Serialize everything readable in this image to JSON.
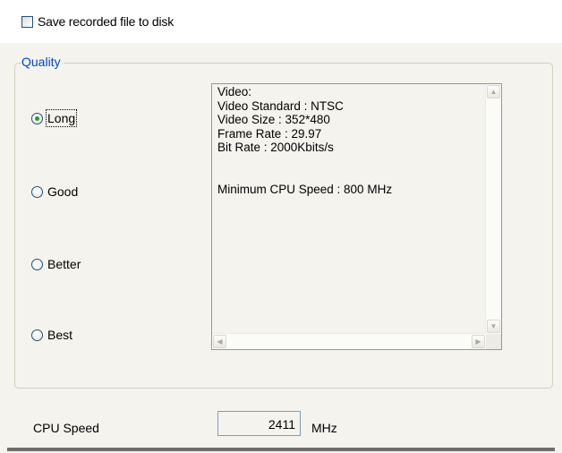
{
  "save": {
    "label": "Save recorded file to disk",
    "checked": false
  },
  "quality": {
    "group_title": "Quality",
    "options": [
      {
        "label": "Long",
        "selected": true
      },
      {
        "label": "Good",
        "selected": false
      },
      {
        "label": "Better",
        "selected": false
      },
      {
        "label": "Best",
        "selected": false
      }
    ],
    "info_lines": "Video:\nVideo Standard : NTSC\nVideo Size : 352*480\nFrame Rate : 29.97\nBit Rate : 2000Kbits/s\n\n\nMinimum CPU Speed : 800 MHz"
  },
  "cpu": {
    "label": "CPU Speed",
    "value": "2411",
    "unit": "MHz"
  },
  "colors": {
    "group_title": "#0046d5",
    "selected_radio": "#21a121",
    "border": "#7f9db9"
  }
}
